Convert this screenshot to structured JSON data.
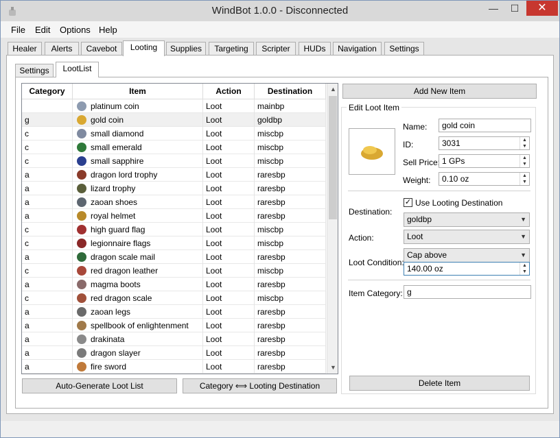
{
  "window": {
    "title": "WindBot 1.0.0 - Disconnected",
    "minimize": "—",
    "maximize": "☐",
    "close": "✕"
  },
  "menu": [
    "File",
    "Edit",
    "Options",
    "Help"
  ],
  "tabs": [
    "Healer",
    "Alerts",
    "Cavebot",
    "Looting",
    "Supplies",
    "Targeting",
    "Scripter",
    "HUDs",
    "Navigation",
    "Settings"
  ],
  "active_tab": "Looting",
  "subtabs": [
    "Settings",
    "LootList"
  ],
  "table": {
    "headers": [
      "Category",
      "Item",
      "Action",
      "Destination"
    ],
    "rows": [
      {
        "category": "",
        "item": "platinum coin",
        "action": "Loot",
        "destination": "mainbp",
        "color": "#8d9bb0"
      },
      {
        "category": "g",
        "item": "gold coin",
        "action": "Loot",
        "destination": "goldbp",
        "color": "#d9a832"
      },
      {
        "category": "c",
        "item": "small diamond",
        "action": "Loot",
        "destination": "miscbp",
        "color": "#7f8aa0"
      },
      {
        "category": "c",
        "item": "small emerald",
        "action": "Loot",
        "destination": "miscbp",
        "color": "#2f7a3a"
      },
      {
        "category": "c",
        "item": "small sapphire",
        "action": "Loot",
        "destination": "miscbp",
        "color": "#2a3f8f"
      },
      {
        "category": "a",
        "item": "dragon lord trophy",
        "action": "Loot",
        "destination": "raresbp",
        "color": "#8a3b2a"
      },
      {
        "category": "a",
        "item": "lizard trophy",
        "action": "Loot",
        "destination": "raresbp",
        "color": "#5a5e3a"
      },
      {
        "category": "a",
        "item": "zaoan shoes",
        "action": "Loot",
        "destination": "raresbp",
        "color": "#5d6670"
      },
      {
        "category": "a",
        "item": "royal helmet",
        "action": "Loot",
        "destination": "raresbp",
        "color": "#b88a2a"
      },
      {
        "category": "c",
        "item": "high guard flag",
        "action": "Loot",
        "destination": "miscbp",
        "color": "#a03030"
      },
      {
        "category": "c",
        "item": "legionnaire flags",
        "action": "Loot",
        "destination": "miscbp",
        "color": "#8a2828"
      },
      {
        "category": "a",
        "item": "dragon scale mail",
        "action": "Loot",
        "destination": "raresbp",
        "color": "#2f6a3a"
      },
      {
        "category": "c",
        "item": "red dragon leather",
        "action": "Loot",
        "destination": "miscbp",
        "color": "#a8483a"
      },
      {
        "category": "a",
        "item": "magma boots",
        "action": "Loot",
        "destination": "raresbp",
        "color": "#8a6a6a"
      },
      {
        "category": "c",
        "item": "red dragon scale",
        "action": "Loot",
        "destination": "miscbp",
        "color": "#a0503a"
      },
      {
        "category": "a",
        "item": "zaoan legs",
        "action": "Loot",
        "destination": "raresbp",
        "color": "#6a6a6a"
      },
      {
        "category": "a",
        "item": "spellbook of enlightenment",
        "action": "Loot",
        "destination": "raresbp",
        "color": "#a07a4a"
      },
      {
        "category": "a",
        "item": "drakinata",
        "action": "Loot",
        "destination": "raresbp",
        "color": "#8a8a8a"
      },
      {
        "category": "a",
        "item": "dragon slayer",
        "action": "Loot",
        "destination": "raresbp",
        "color": "#7a7a7a"
      },
      {
        "category": "a",
        "item": "fire sword",
        "action": "Loot",
        "destination": "raresbp",
        "color": "#c07a3a"
      }
    ]
  },
  "buttons": {
    "auto_generate": "Auto-Generate Loot List",
    "category_dest": "Category ⟺ Looting Destination",
    "add_new": "Add New Item",
    "delete": "Delete Item"
  },
  "edit": {
    "title": "Edit Loot Item",
    "name_label": "Name:",
    "name_value": "gold coin",
    "id_label": "ID:",
    "id_value": "3031",
    "price_label": "Sell Price:",
    "price_value": "1 GPs",
    "weight_label": "Weight:",
    "weight_value": "0.10 oz",
    "destination_label": "Destination:",
    "use_dest_label": "Use Looting Destination",
    "use_dest_checked": "✓",
    "destination_value": "goldbp",
    "action_label": "Action:",
    "action_value": "Loot",
    "condition_label": "Loot Condition:",
    "condition_value": "Cap above",
    "condition_amount": "140.00 oz",
    "category_label": "Item Category:",
    "category_value": "g"
  }
}
